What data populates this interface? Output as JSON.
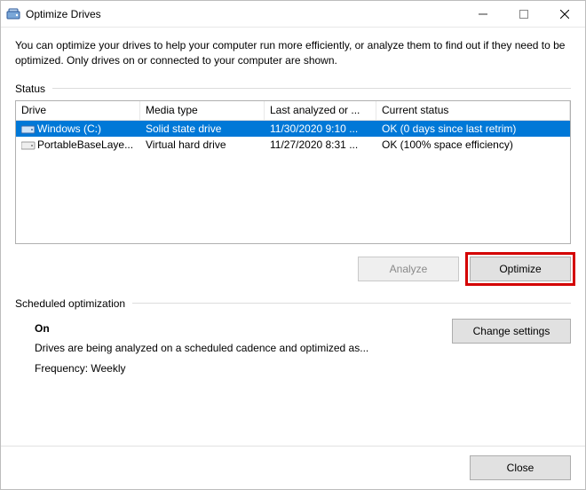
{
  "window": {
    "title": "Optimize Drives"
  },
  "description": "You can optimize your drives to help your computer run more efficiently, or analyze them to find out if they need to be optimized. Only drives on or connected to your computer are shown.",
  "status_group_label": "Status",
  "columns": {
    "drive": "Drive",
    "media": "Media type",
    "last": "Last analyzed or ...",
    "status": "Current status"
  },
  "rows": [
    {
      "drive": "Windows (C:)",
      "media": "Solid state drive",
      "last": "11/30/2020 9:10 ...",
      "status": "OK (0 days since last retrim)",
      "selected": true
    },
    {
      "drive": "PortableBaseLaye...",
      "media": "Virtual hard drive",
      "last": "11/27/2020 8:31 ...",
      "status": "OK (100% space efficiency)",
      "selected": false
    }
  ],
  "buttons": {
    "analyze": "Analyze",
    "optimize": "Optimize",
    "change_settings": "Change settings",
    "close": "Close"
  },
  "sched": {
    "group_label": "Scheduled optimization",
    "on_label": "On",
    "detail": "Drives are being analyzed on a scheduled cadence and optimized as...",
    "frequency": "Frequency: Weekly"
  }
}
